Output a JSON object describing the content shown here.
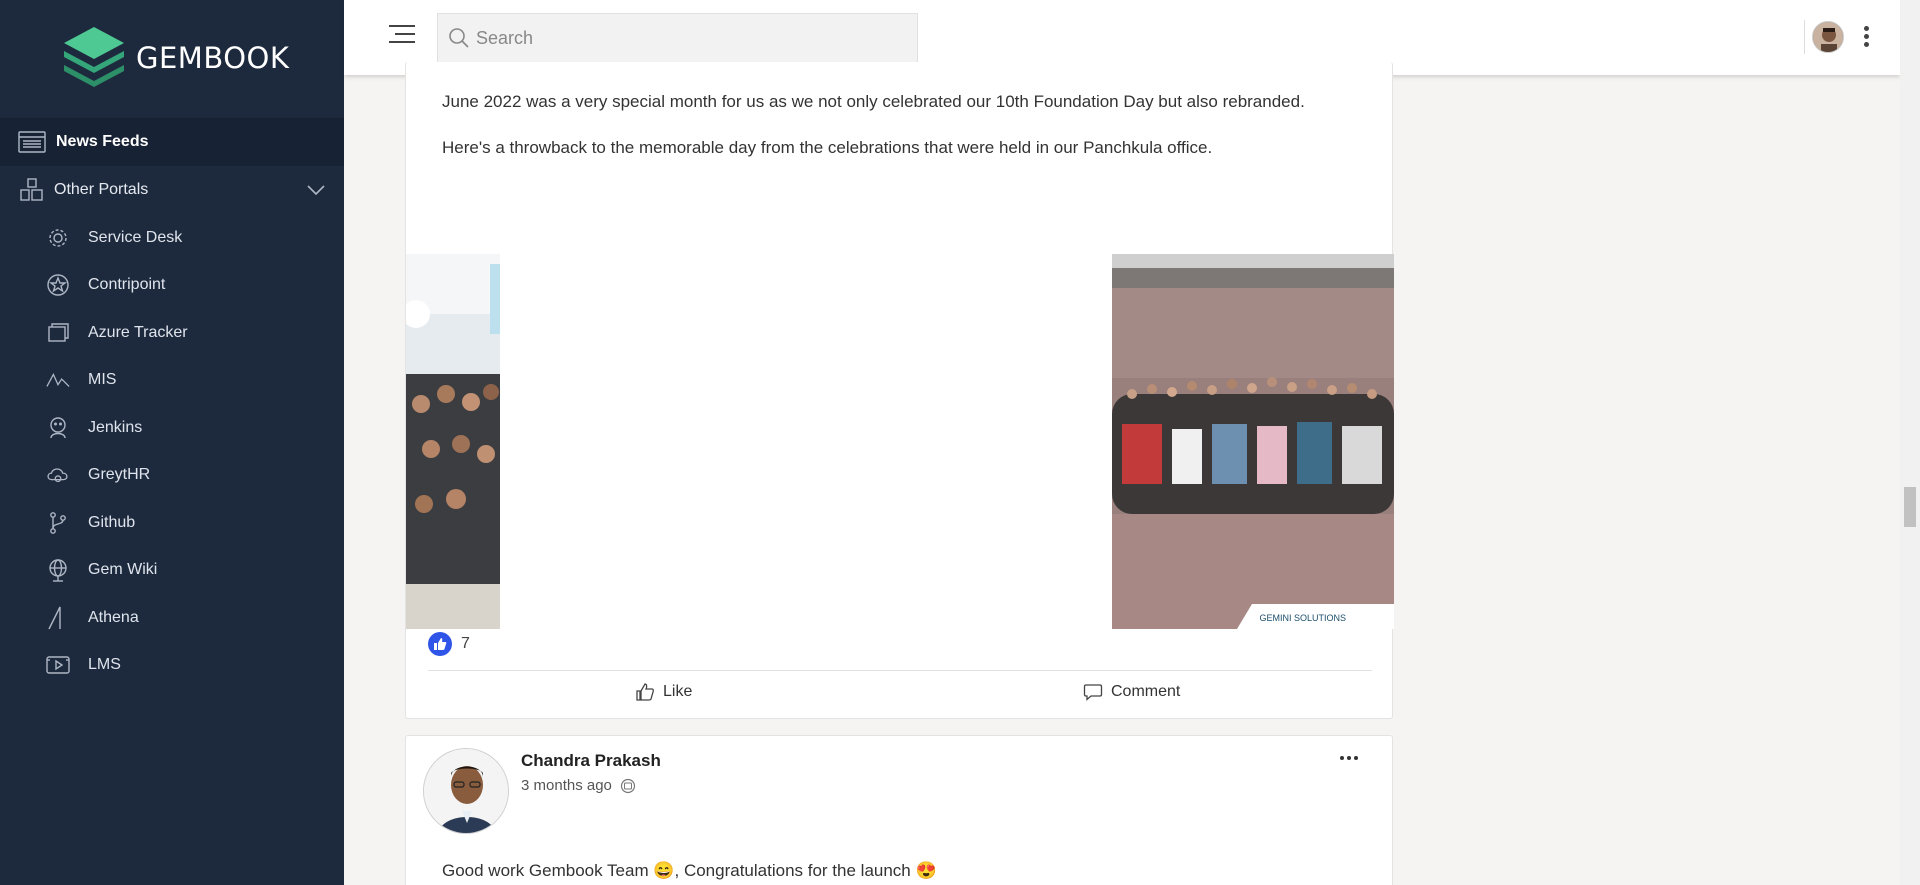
{
  "sidebar": {
    "brand": "GEMBOOK",
    "news_feeds": "News Feeds",
    "other_portals": "Other Portals",
    "portals": [
      {
        "label": "Service Desk",
        "icon": "gear-icon"
      },
      {
        "label": "Contripoint",
        "icon": "star-badge-icon"
      },
      {
        "label": "Azure Tracker",
        "icon": "tracker-icon"
      },
      {
        "label": "MIS",
        "icon": "wave-icon"
      },
      {
        "label": "Jenkins",
        "icon": "jenkins-icon"
      },
      {
        "label": "GreytHR",
        "icon": "cloud-icon"
      },
      {
        "label": "Github",
        "icon": "branch-icon"
      },
      {
        "label": "Gem Wiki",
        "icon": "globe-icon"
      },
      {
        "label": "Athena",
        "icon": "athena-icon"
      },
      {
        "label": "LMS",
        "icon": "video-icon"
      }
    ]
  },
  "topbar": {
    "search_placeholder": "Search"
  },
  "post1": {
    "paragraph1": "June 2022 was a very special month for us as we not only celebrated our 10th Foundation Day but also rebranded.",
    "paragraph2": "Here's a throwback to the memorable day from the celebrations that were held in our Panchkula office.",
    "watermark": "GEMINI SOLUTIONS",
    "like_count": "7",
    "like_label": "Like",
    "comment_label": "Comment"
  },
  "post2": {
    "author": "Chandra Prakash",
    "time": "3 months ago",
    "text": "Good work Gembook Team 😄, Congratulations for the launch 😍"
  },
  "colors": {
    "sidebar_bg": "#1d2a3e",
    "like_blue": "#2f55e8",
    "logo_green": "#3fbf8a"
  }
}
